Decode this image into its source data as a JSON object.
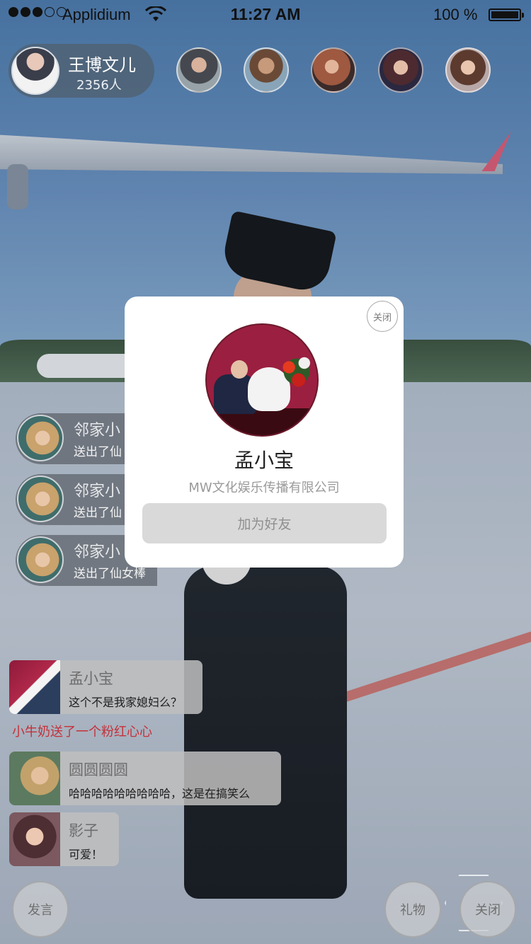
{
  "status_bar": {
    "carrier": "Applidium",
    "time": "11:27 AM",
    "battery": "100 %"
  },
  "host": {
    "name": "王博文儿",
    "viewer_count": "2356人"
  },
  "viewers": [
    {
      "name": "viewer-1"
    },
    {
      "name": "viewer-2"
    },
    {
      "name": "viewer-3"
    },
    {
      "name": "viewer-4"
    },
    {
      "name": "viewer-5"
    }
  ],
  "gift_notifications": [
    {
      "user": "邻家小",
      "text": "送出了仙"
    },
    {
      "user": "邻家小",
      "text": "送出了仙"
    },
    {
      "user": "邻家小",
      "text": "送出了仙女棒"
    }
  ],
  "chat_messages": [
    {
      "name": "孟小宝",
      "text": "这个不是我家媳妇么？"
    },
    {
      "name": "圆圆圆圆",
      "text": "哈哈哈哈哈哈哈哈哈，这是在搞笑么"
    },
    {
      "name": "影子",
      "text": "可爱！"
    }
  ],
  "system_message": "小牛奶送了一个粉红心心",
  "buttons": {
    "speak": "发言",
    "gift": "礼物",
    "close": "关闭"
  },
  "profile_card": {
    "close_label": "关闭",
    "name": "孟小宝",
    "company": "MW文化娱乐传播有限公司",
    "add_friend_label": "加为好友"
  },
  "colors": {
    "system_message": "#c4313a",
    "card_background": "#ffffff",
    "add_button": "#d9d9d9"
  }
}
